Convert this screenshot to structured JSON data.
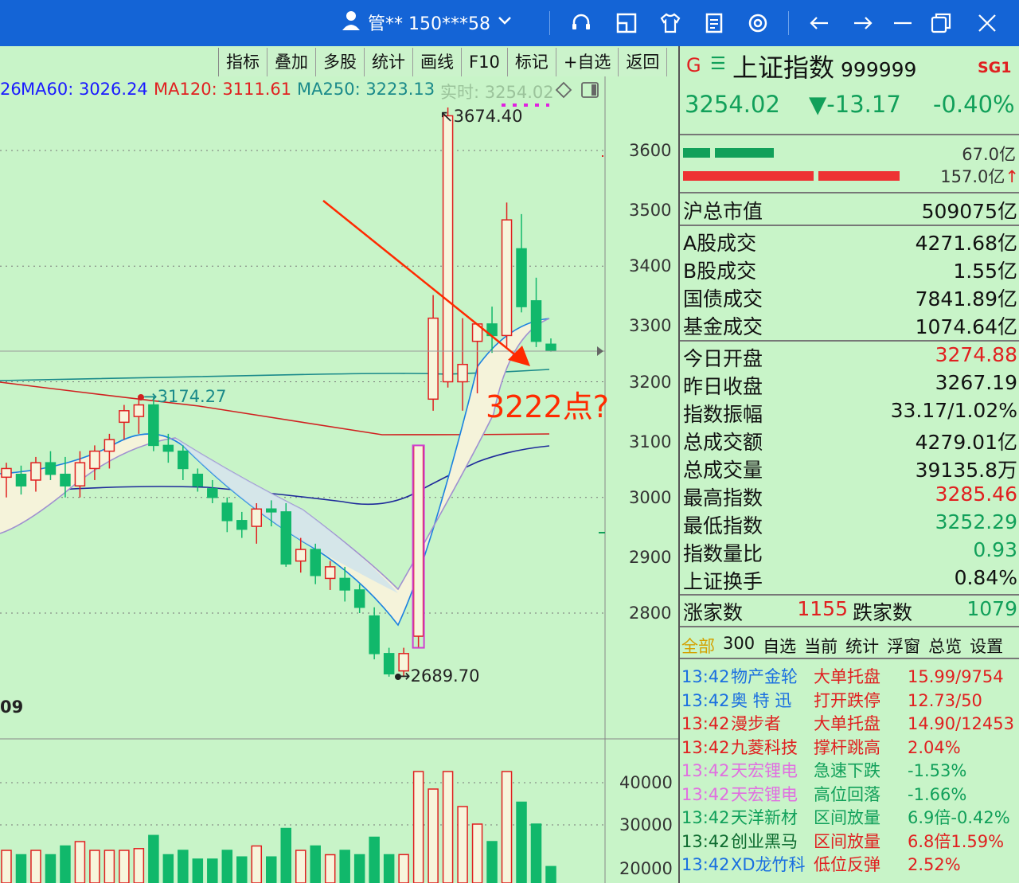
{
  "titlebar": {
    "user_label": "管** 150***58",
    "icons": [
      "user-icon",
      "chevron-down-icon",
      "headset-icon",
      "layout-icon",
      "shirt-icon",
      "notes-icon",
      "settings-icon",
      "back-arrow-icon",
      "forward-arrow-icon",
      "minimize-icon",
      "restore-icon",
      "close-icon"
    ]
  },
  "toolbar": {
    "buttons": [
      "指标",
      "叠加",
      "多股",
      "统计",
      "画线",
      "F10",
      "标记",
      "+自选",
      "返回"
    ]
  },
  "ma": {
    "ma_prefix": "26",
    "ma60": "MA60: 3026.24",
    "ma120": "MA120: 3111.61",
    "ma250": "MA250: 3223.13",
    "realtime": "实时: 3254.02"
  },
  "colors": {
    "ma60": "#1a1aff",
    "ma120": "#e02020",
    "ma250": "#1a8a8a",
    "up": "#e02020",
    "down": "#11b86b",
    "annot": "#ff2a00"
  },
  "chart_labels": {
    "high_mark": "3674.40",
    "low_mark": "2689.70",
    "mid_mark": "3174.27",
    "annotation": "3222点?",
    "left_date": "09"
  },
  "chart_data": {
    "type": "candlestick",
    "price_axis_ticks": [
      "3600",
      "3500",
      "3400",
      "3300",
      "3200",
      "3100",
      "3000",
      "2900",
      "2800"
    ],
    "volume_axis_ticks": [
      "40000",
      "30000",
      "20000"
    ],
    "candles": [
      {
        "o": 3035,
        "h": 3060,
        "l": 3000,
        "c": 3050
      },
      {
        "o": 3040,
        "h": 3055,
        "l": 3005,
        "c": 3020
      },
      {
        "o": 3030,
        "h": 3070,
        "l": 3010,
        "c": 3060
      },
      {
        "o": 3060,
        "h": 3080,
        "l": 3030,
        "c": 3040
      },
      {
        "o": 3040,
        "h": 3070,
        "l": 3000,
        "c": 3020
      },
      {
        "o": 3020,
        "h": 3080,
        "l": 3000,
        "c": 3060
      },
      {
        "o": 3050,
        "h": 3090,
        "l": 3030,
        "c": 3080
      },
      {
        "o": 3080,
        "h": 3110,
        "l": 3050,
        "c": 3100
      },
      {
        "o": 3130,
        "h": 3160,
        "l": 3100,
        "c": 3150
      },
      {
        "o": 3140,
        "h": 3174,
        "l": 3110,
        "c": 3160
      },
      {
        "o": 3160,
        "h": 3174,
        "l": 3080,
        "c": 3090
      },
      {
        "o": 3090,
        "h": 3110,
        "l": 3060,
        "c": 3080
      },
      {
        "o": 3080,
        "h": 3090,
        "l": 3030,
        "c": 3050
      },
      {
        "o": 3040,
        "h": 3050,
        "l": 3010,
        "c": 3020
      },
      {
        "o": 3015,
        "h": 3030,
        "l": 2990,
        "c": 3000
      },
      {
        "o": 2990,
        "h": 3000,
        "l": 2940,
        "c": 2960
      },
      {
        "o": 2960,
        "h": 2975,
        "l": 2930,
        "c": 2945
      },
      {
        "o": 2950,
        "h": 2990,
        "l": 2920,
        "c": 2980
      },
      {
        "o": 2980,
        "h": 2995,
        "l": 2950,
        "c": 2975
      },
      {
        "o": 2975,
        "h": 2990,
        "l": 2880,
        "c": 2885
      },
      {
        "o": 2890,
        "h": 2930,
        "l": 2870,
        "c": 2910
      },
      {
        "o": 2910,
        "h": 2920,
        "l": 2850,
        "c": 2865
      },
      {
        "o": 2860,
        "h": 2890,
        "l": 2840,
        "c": 2880
      },
      {
        "o": 2860,
        "h": 2880,
        "l": 2820,
        "c": 2840
      },
      {
        "o": 2840,
        "h": 2850,
        "l": 2800,
        "c": 2810
      },
      {
        "o": 2795,
        "h": 2810,
        "l": 2720,
        "c": 2730
      },
      {
        "o": 2730,
        "h": 2740,
        "l": 2690,
        "c": 2695
      },
      {
        "o": 2700,
        "h": 2740,
        "l": 2689.7,
        "c": 2730
      },
      {
        "o": 2760,
        "h": 3090,
        "l": 2740,
        "c": 3090
      },
      {
        "o": 3170,
        "h": 3350,
        "l": 3150,
        "c": 3310
      },
      {
        "o": 3200,
        "h": 3674.4,
        "l": 3190,
        "c": 3660
      },
      {
        "o": 3200,
        "h": 3310,
        "l": 3150,
        "c": 3230
      },
      {
        "o": 3270,
        "h": 3300,
        "l": 3180,
        "c": 3300
      },
      {
        "o": 3300,
        "h": 3330,
        "l": 3250,
        "c": 3280
      },
      {
        "o": 3280,
        "h": 3510,
        "l": 3260,
        "c": 3480
      },
      {
        "o": 3430,
        "h": 3490,
        "l": 3320,
        "c": 3330
      },
      {
        "o": 3340,
        "h": 3380,
        "l": 3260,
        "c": 3270
      },
      {
        "o": 3265,
        "h": 3275,
        "l": 3252,
        "c": 3254
      }
    ],
    "ylim": [
      2650,
      3720
    ]
  },
  "right": {
    "code_title": "上证指数",
    "code": "999999",
    "corner": "SG1",
    "price": "3254.02",
    "change": "▼-13.17",
    "pct": "-0.40%",
    "bar_top_val": "67.0亿",
    "bar_bot_val": "157.0亿",
    "market_cap_label": "沪总市值",
    "market_cap": "509075亿",
    "rows1": [
      {
        "label": "A股成交",
        "value": "4271.68亿"
      },
      {
        "label": "B股成交",
        "value": "1.55亿"
      },
      {
        "label": "国债成交",
        "value": "7841.89亿"
      },
      {
        "label": "基金成交",
        "value": "1074.64亿"
      }
    ],
    "rows2": [
      {
        "label": "今日开盘",
        "value": "3274.88",
        "color": "#e02020"
      },
      {
        "label": "昨日收盘",
        "value": "3267.19",
        "color": "#111"
      },
      {
        "label": "指数振幅",
        "value": "33.17/1.02%",
        "color": "#111"
      },
      {
        "label": "总成交额",
        "value": "4279.01亿",
        "color": "#111"
      },
      {
        "label": "总成交量",
        "value": "39135.8万",
        "color": "#111"
      },
      {
        "label": "最高指数",
        "value": "3285.46",
        "color": "#e02020"
      },
      {
        "label": "最低指数",
        "value": "3252.29",
        "color": "#11a05a"
      },
      {
        "label": "指数量比",
        "value": "0.93",
        "color": "#11a05a"
      },
      {
        "label": "上证换手",
        "value": "0.84%",
        "color": "#111"
      }
    ],
    "up_label": "涨家数",
    "up_count": "1155",
    "down_label": "跌家数",
    "down_count": "1079",
    "tabs": [
      "全部",
      "300",
      "自选",
      "当前",
      "统计",
      "浮窗",
      "总览",
      "设置"
    ],
    "news": [
      {
        "time": "13:42",
        "name": "物产金轮",
        "event": "大单托盘",
        "val": "15.99/9754",
        "c": "#1a6fe0",
        "ec": "#e02020"
      },
      {
        "time": "13:42",
        "name": "奥 特 迅",
        "event": "打开跌停",
        "val": "12.73/50",
        "c": "#1a6fe0",
        "ec": "#e02020"
      },
      {
        "time": "13:42",
        "name": "漫步者",
        "event": "大单托盘",
        "val": "14.90/12453",
        "c": "#e02020",
        "ec": "#e02020"
      },
      {
        "time": "13:42",
        "name": "九菱科技",
        "event": "撑杆跳高",
        "val": "2.04%",
        "c": "#e02020",
        "ec": "#e02020"
      },
      {
        "time": "13:42",
        "name": "天宏锂电",
        "event": "急速下跌",
        "val": "-1.53%",
        "c": "#e070e0",
        "ec": "#11a05a"
      },
      {
        "time": "13:42",
        "name": "天宏锂电",
        "event": "高位回落",
        "val": "-1.66%",
        "c": "#e070e0",
        "ec": "#11a05a"
      },
      {
        "time": "13:42",
        "name": "天洋新材",
        "event": "区间放量",
        "val": "6.9倍-0.42%",
        "c": "#11a05a",
        "ec": "#11a05a"
      },
      {
        "time": "13:42",
        "name": "创业黑马",
        "event": "区间放量",
        "val": "6.8倍1.59%",
        "c": "#0d6b2f",
        "ec": "#e02020"
      },
      {
        "time": "13:42",
        "name": "XD龙竹科",
        "event": "低位反弹",
        "val": "2.52%",
        "c": "#1a6fe0",
        "ec": "#e02020"
      }
    ]
  }
}
